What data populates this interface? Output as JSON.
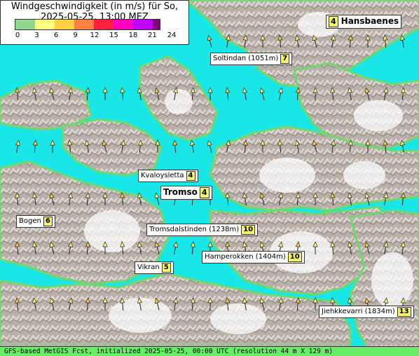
{
  "title": "Windgeschwindigkeit (in m/s) für So, 2025-05-25, 13:00 MEZ",
  "legend": {
    "ticks": [
      "0",
      "3",
      "6",
      "9",
      "12",
      "15",
      "18",
      "21",
      "24"
    ],
    "colors": [
      "#90d890",
      "#ffff80",
      "#ffd040",
      "#ff8040",
      "#ff2040",
      "#ff00c0",
      "#c000ff",
      "#800080"
    ]
  },
  "places": [
    {
      "name": "Hansbaenes",
      "value": "4",
      "valueFirst": true
    },
    {
      "name": "Soltindan (1051m)",
      "value": "7"
    },
    {
      "name": "Kvaloysletta",
      "value": "4"
    },
    {
      "name": "Tromso",
      "value": "4",
      "big": true
    },
    {
      "name": "Bogen",
      "value": "6"
    },
    {
      "name": "Tromsdalstinden (1238m)",
      "value": "10"
    },
    {
      "name": "Hamperokken (1404m)",
      "value": "10"
    },
    {
      "name": "Vikran",
      "value": "5"
    },
    {
      "name": "Jiehkkevarri (1834m)",
      "value": "13"
    }
  ],
  "footer": "GFS-based MetGIS Fcst, initialized 2025-05-25, 00:00 UTC  (resolution 44 m X 129 m)",
  "colors": {
    "water": "#19e6e6",
    "land": "#b8b0a8",
    "lowland": "#7ee07e",
    "snow": "#ffffff"
  }
}
